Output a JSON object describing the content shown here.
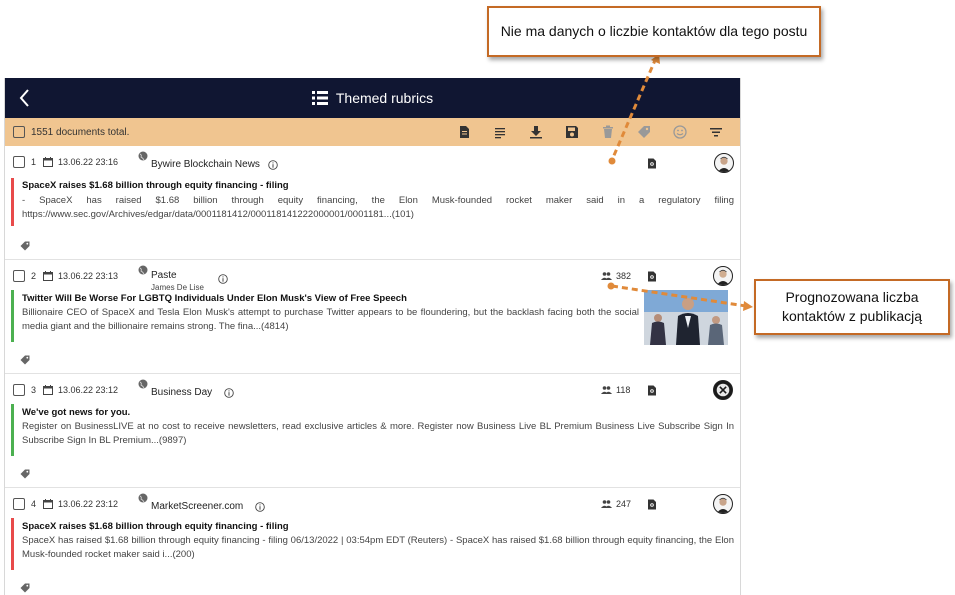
{
  "header": {
    "title": "Themed rubrics",
    "back_icon": "chevron-left-icon",
    "title_icon": "list-icon"
  },
  "toolbar": {
    "total_label": "1551 documents total.",
    "tools": [
      "document-icon",
      "text-lines-icon",
      "download-icon",
      "save-icon",
      "trash-icon",
      "tag-icon",
      "smiley-icon",
      "filter-icon"
    ]
  },
  "documents": [
    {
      "num": "1",
      "date": "13.06.22 23:16",
      "source": "Bywire Blockchain News",
      "author": "",
      "headline": "SpaceX raises $1.68 billion through equity financing - filing",
      "snippet": "- SpaceX has raised $1.68 billion through equity financing, the Elon Musk-founded rocket maker said in a regulatory filing https://www.sec.gov/Archives/edgar/data/0001181412/000118141222000001/0001181...(101)",
      "reach": "",
      "sentiment": "red"
    },
    {
      "num": "2",
      "date": "13.06.22 23:13",
      "source": "Paste",
      "author": "James De Lise",
      "headline": "Twitter Will Be Worse For LGBTQ Individuals Under Elon Musk's View of Free Speech",
      "snippet": "Billionaire CEO of SpaceX and Tesla Elon Musk's attempt to purchase Twitter appears to be floundering, but the backlash facing both the social media giant and the billionaire remains strong. The fina...(4814)",
      "reach": "382",
      "sentiment": "green"
    },
    {
      "num": "3",
      "date": "13.06.22 23:12",
      "source": "Business Day",
      "author": "",
      "headline": "We've got news for you.",
      "snippet": "Register on BusinessLIVE at no cost to receive newsletters, read exclusive articles & more. Register now Business Live BL Premium Business Live Subscribe Sign In Subscribe Sign In BL Premium...(9897)",
      "reach": "118",
      "sentiment": "green"
    },
    {
      "num": "4",
      "date": "13.06.22 23:12",
      "source": "MarketScreener.com",
      "author": "",
      "headline": "SpaceX raises $1.68 billion through equity financing - filing",
      "snippet": "SpaceX has raised $1.68 billion through equity financing - filing 06/13/2022 | 03:54pm EDT (Reuters) - SpaceX has raised $1.68 billion through equity financing, the Elon Musk-founded rocket maker said i...(200)",
      "reach": "247",
      "sentiment": "red"
    }
  ],
  "annotations": {
    "no_reach": "Nie ma danych o liczbie kontaktów dla tego postu",
    "forecast_reach": "Prognozowana liczba kontaktów z publikacją"
  },
  "colors": {
    "topbar": "#101632",
    "toolbar": "#f0c590",
    "negative": "#e84a4a",
    "positive": "#4cb050",
    "callout_border": "#c46a25"
  }
}
